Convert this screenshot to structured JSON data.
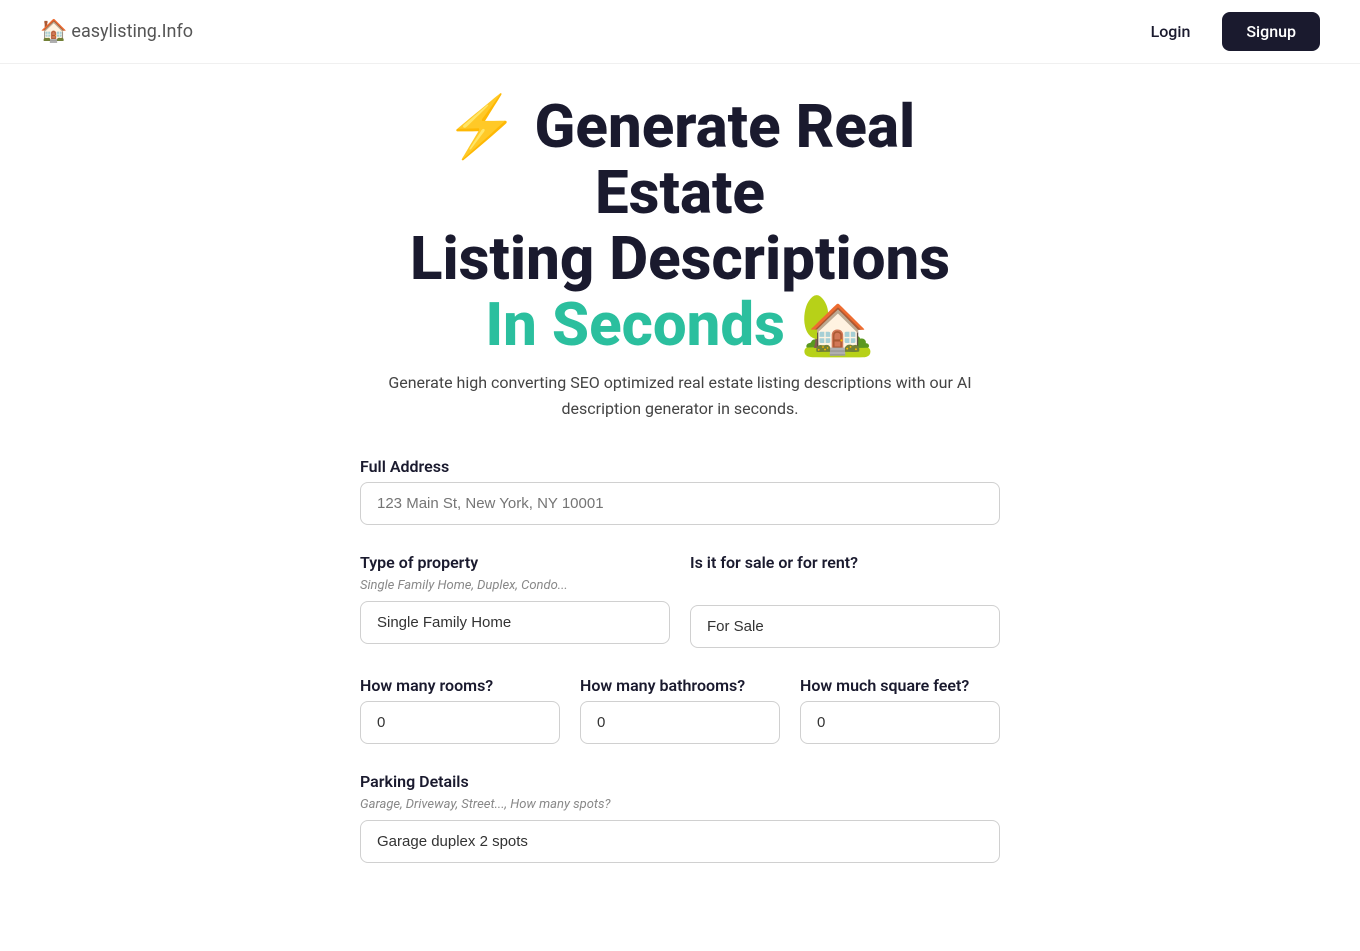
{
  "header": {
    "logo_icon": "🏠",
    "logo_brand": "easylisting",
    "logo_domain": ".Info",
    "nav_login": "Login",
    "nav_signup": "Signup"
  },
  "hero": {
    "lightning": "⚡",
    "title_line1": "Generate Real Estate",
    "title_line2": "Listing Descriptions",
    "title_line3_text": "In Seconds",
    "title_line3_emoji": "🏡",
    "subtitle": "Generate high converting SEO optimized real estate listing descriptions with our AI description generator in seconds."
  },
  "form": {
    "full_address": {
      "label": "Full Address",
      "placeholder": "123 Main St, New York, NY 10001",
      "value": ""
    },
    "property_type": {
      "label": "Type of property",
      "sublabel": "Single Family Home, Duplex, Condo...",
      "value": "Single Family Home"
    },
    "sale_or_rent": {
      "label": "Is it for sale or for rent?",
      "value": "For Sale"
    },
    "rooms": {
      "label": "How many rooms?",
      "value": "0"
    },
    "bathrooms": {
      "label": "How many bathrooms?",
      "value": "0"
    },
    "square_feet": {
      "label": "How much square feet?",
      "value": "0"
    },
    "parking": {
      "label": "Parking Details",
      "sublabel": "Garage, Driveway, Street..., How many spots?",
      "placeholder": "Garage duplex 2 spots",
      "value": "Garage duplex 2 spots"
    }
  }
}
